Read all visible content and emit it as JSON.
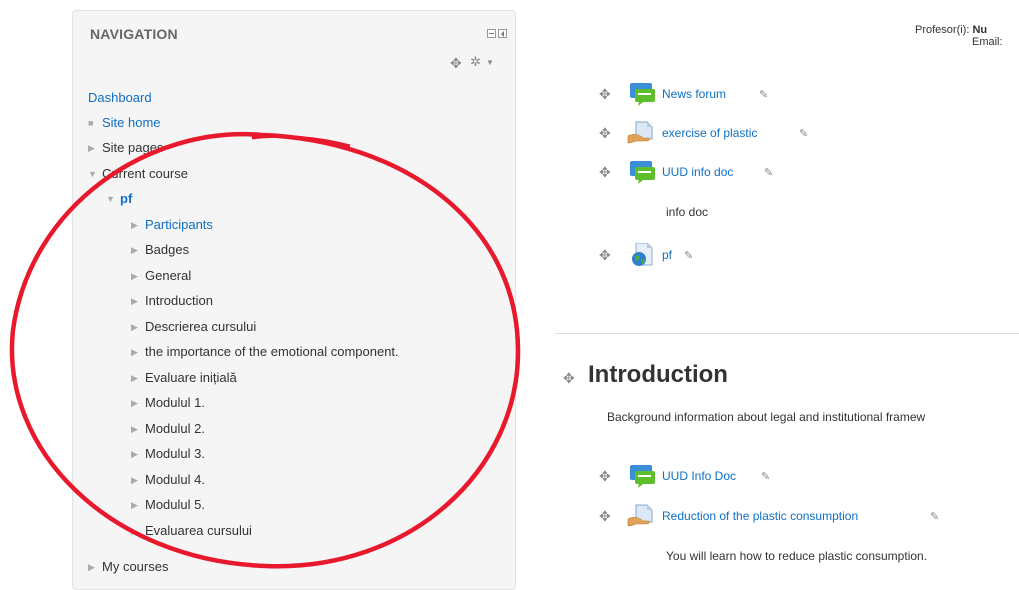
{
  "nav": {
    "title": "NAVIGATION",
    "dashboard": "Dashboard",
    "site_home": "Site home",
    "site_pages": "Site pages",
    "current_course": "Current course",
    "course_short": "pf",
    "course_items": [
      "Participants",
      "Badges",
      "General",
      "Introduction",
      "Descrierea cursului",
      "the importance of the emotional component.",
      "Evaluare inițială",
      "Modulul 1.",
      "Modulul 2.",
      "Modulul 3.",
      "Modulul 4.",
      "Modulul 5.",
      "Evaluarea cursului"
    ],
    "my_courses": "My courses"
  },
  "teacher": {
    "label": "Profesor(i): ",
    "name_fragment": "Nu",
    "email_label": "Email:"
  },
  "activities": [
    {
      "name": "News forum",
      "icon": "forum-icon"
    },
    {
      "name": "exercise of plastic",
      "icon": "assignment-icon"
    },
    {
      "name": "UUD info doc",
      "icon": "forum-icon",
      "description": "info doc"
    },
    {
      "name": "pf",
      "icon": "url-icon"
    }
  ],
  "section": {
    "title": "Introduction",
    "summary": "Background information about legal and institutional framew",
    "activities": [
      {
        "name": "UUD Info Doc",
        "icon": "forum-icon"
      },
      {
        "name": "Reduction of the plastic consumption",
        "icon": "assignment-icon",
        "description": "You will learn how to reduce plastic consumption."
      }
    ]
  },
  "colors": {
    "link": "#0f6fc5",
    "annotation_ring": "#e8192c",
    "block_bg": "#f5f5f5"
  }
}
